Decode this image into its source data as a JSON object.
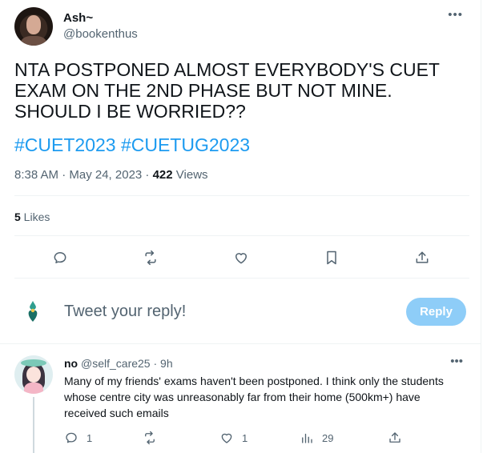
{
  "tweet": {
    "display_name": "Ash~",
    "handle": "@bookenthus",
    "text": "NTA POSTPONED ALMOST EVERYBODY'S CUET EXAM ON THE 2ND PHASE BUT NOT MINE. SHOULD I BE WORRIED??",
    "hashtags": "#CUET2023 #CUETUG2023",
    "time": "8:38 AM · May 24, 2023 · ",
    "views_count": "422",
    "views_label": " Views",
    "likes_count": "5",
    "likes_label": " Likes",
    "more_icon": "more-horizontal-icon",
    "actions": [
      "reply-icon",
      "retweet-icon",
      "like-icon",
      "bookmark-icon",
      "share-icon"
    ]
  },
  "composer": {
    "placeholder": "Tweet your reply!",
    "button_label": "Reply",
    "button_color": "#8ecdf8"
  },
  "reply": {
    "display_name": "no",
    "handle": "@self_care25",
    "time": " · 9h",
    "text": "Many of my friends' exams haven't been postponed. I think only the students whose centre city was unreasonably far from their home (500km+) have received such emails",
    "reply_count": "1",
    "retweet_count": "",
    "like_count": "1",
    "views_count": "29"
  },
  "colors": {
    "accent": "#1d9bf0",
    "secondary_text": "#536471",
    "primary_text": "#0f1419"
  }
}
